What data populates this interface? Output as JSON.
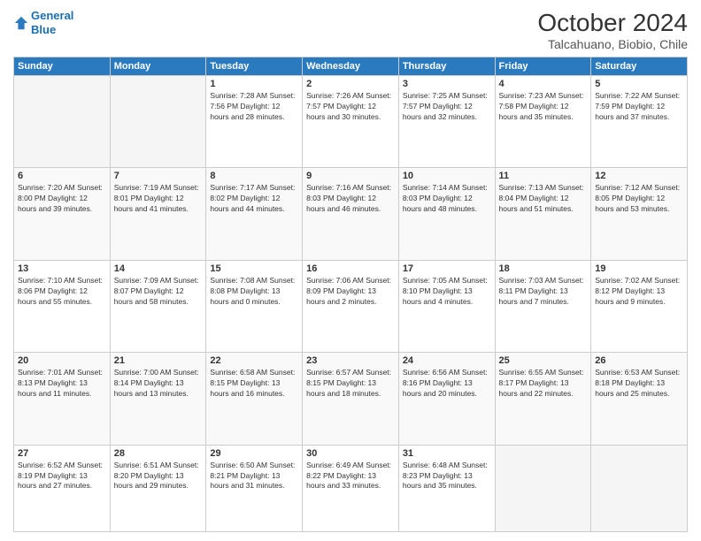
{
  "header": {
    "logo_line1": "General",
    "logo_line2": "Blue",
    "title": "October 2024",
    "subtitle": "Talcahuano, Biobio, Chile"
  },
  "days_of_week": [
    "Sunday",
    "Monday",
    "Tuesday",
    "Wednesday",
    "Thursday",
    "Friday",
    "Saturday"
  ],
  "weeks": [
    [
      {
        "day": "",
        "info": ""
      },
      {
        "day": "",
        "info": ""
      },
      {
        "day": "1",
        "info": "Sunrise: 7:28 AM\nSunset: 7:56 PM\nDaylight: 12 hours and 28 minutes."
      },
      {
        "day": "2",
        "info": "Sunrise: 7:26 AM\nSunset: 7:57 PM\nDaylight: 12 hours and 30 minutes."
      },
      {
        "day": "3",
        "info": "Sunrise: 7:25 AM\nSunset: 7:57 PM\nDaylight: 12 hours and 32 minutes."
      },
      {
        "day": "4",
        "info": "Sunrise: 7:23 AM\nSunset: 7:58 PM\nDaylight: 12 hours and 35 minutes."
      },
      {
        "day": "5",
        "info": "Sunrise: 7:22 AM\nSunset: 7:59 PM\nDaylight: 12 hours and 37 minutes."
      }
    ],
    [
      {
        "day": "6",
        "info": "Sunrise: 7:20 AM\nSunset: 8:00 PM\nDaylight: 12 hours and 39 minutes."
      },
      {
        "day": "7",
        "info": "Sunrise: 7:19 AM\nSunset: 8:01 PM\nDaylight: 12 hours and 41 minutes."
      },
      {
        "day": "8",
        "info": "Sunrise: 7:17 AM\nSunset: 8:02 PM\nDaylight: 12 hours and 44 minutes."
      },
      {
        "day": "9",
        "info": "Sunrise: 7:16 AM\nSunset: 8:03 PM\nDaylight: 12 hours and 46 minutes."
      },
      {
        "day": "10",
        "info": "Sunrise: 7:14 AM\nSunset: 8:03 PM\nDaylight: 12 hours and 48 minutes."
      },
      {
        "day": "11",
        "info": "Sunrise: 7:13 AM\nSunset: 8:04 PM\nDaylight: 12 hours and 51 minutes."
      },
      {
        "day": "12",
        "info": "Sunrise: 7:12 AM\nSunset: 8:05 PM\nDaylight: 12 hours and 53 minutes."
      }
    ],
    [
      {
        "day": "13",
        "info": "Sunrise: 7:10 AM\nSunset: 8:06 PM\nDaylight: 12 hours and 55 minutes."
      },
      {
        "day": "14",
        "info": "Sunrise: 7:09 AM\nSunset: 8:07 PM\nDaylight: 12 hours and 58 minutes."
      },
      {
        "day": "15",
        "info": "Sunrise: 7:08 AM\nSunset: 8:08 PM\nDaylight: 13 hours and 0 minutes."
      },
      {
        "day": "16",
        "info": "Sunrise: 7:06 AM\nSunset: 8:09 PM\nDaylight: 13 hours and 2 minutes."
      },
      {
        "day": "17",
        "info": "Sunrise: 7:05 AM\nSunset: 8:10 PM\nDaylight: 13 hours and 4 minutes."
      },
      {
        "day": "18",
        "info": "Sunrise: 7:03 AM\nSunset: 8:11 PM\nDaylight: 13 hours and 7 minutes."
      },
      {
        "day": "19",
        "info": "Sunrise: 7:02 AM\nSunset: 8:12 PM\nDaylight: 13 hours and 9 minutes."
      }
    ],
    [
      {
        "day": "20",
        "info": "Sunrise: 7:01 AM\nSunset: 8:13 PM\nDaylight: 13 hours and 11 minutes."
      },
      {
        "day": "21",
        "info": "Sunrise: 7:00 AM\nSunset: 8:14 PM\nDaylight: 13 hours and 13 minutes."
      },
      {
        "day": "22",
        "info": "Sunrise: 6:58 AM\nSunset: 8:15 PM\nDaylight: 13 hours and 16 minutes."
      },
      {
        "day": "23",
        "info": "Sunrise: 6:57 AM\nSunset: 8:15 PM\nDaylight: 13 hours and 18 minutes."
      },
      {
        "day": "24",
        "info": "Sunrise: 6:56 AM\nSunset: 8:16 PM\nDaylight: 13 hours and 20 minutes."
      },
      {
        "day": "25",
        "info": "Sunrise: 6:55 AM\nSunset: 8:17 PM\nDaylight: 13 hours and 22 minutes."
      },
      {
        "day": "26",
        "info": "Sunrise: 6:53 AM\nSunset: 8:18 PM\nDaylight: 13 hours and 25 minutes."
      }
    ],
    [
      {
        "day": "27",
        "info": "Sunrise: 6:52 AM\nSunset: 8:19 PM\nDaylight: 13 hours and 27 minutes."
      },
      {
        "day": "28",
        "info": "Sunrise: 6:51 AM\nSunset: 8:20 PM\nDaylight: 13 hours and 29 minutes."
      },
      {
        "day": "29",
        "info": "Sunrise: 6:50 AM\nSunset: 8:21 PM\nDaylight: 13 hours and 31 minutes."
      },
      {
        "day": "30",
        "info": "Sunrise: 6:49 AM\nSunset: 8:22 PM\nDaylight: 13 hours and 33 minutes."
      },
      {
        "day": "31",
        "info": "Sunrise: 6:48 AM\nSunset: 8:23 PM\nDaylight: 13 hours and 35 minutes."
      },
      {
        "day": "",
        "info": ""
      },
      {
        "day": "",
        "info": ""
      }
    ]
  ]
}
